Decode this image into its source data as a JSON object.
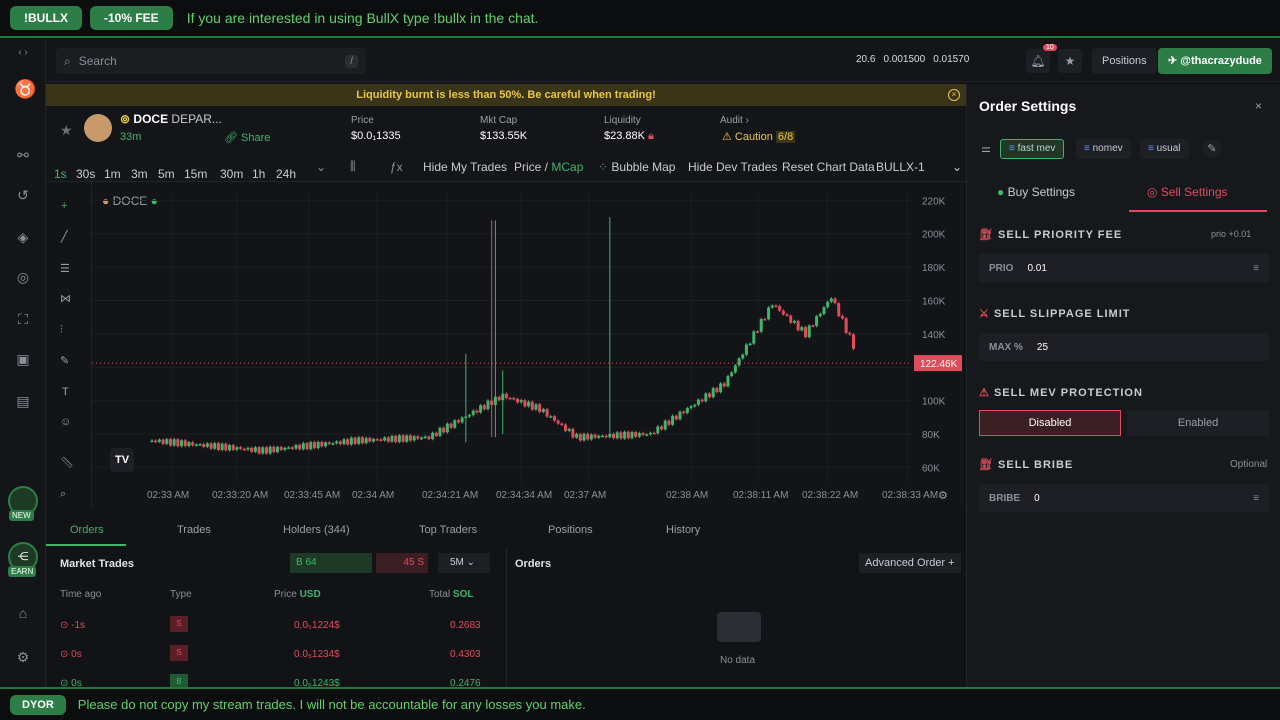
{
  "top_banner": {
    "pill1": "!BULLX",
    "pill2": "-10% FEE",
    "text": "If you are interested in using BullX type !bullx in the chat."
  },
  "bottom_banner": {
    "pill": "DYOR",
    "text": "Please do not copy my stream trades. I will not be accountable for any losses you make."
  },
  "header": {
    "search_placeholder": "Search",
    "search_shortcut": "/",
    "stat1": "20.6",
    "stat2": "0.001500",
    "stat3": "0.01570",
    "notif_count": "10",
    "positions": "Positions",
    "telegram": "@thacrazydude"
  },
  "sidebar_badges": {
    "new": "NEW",
    "earn": "EARN"
  },
  "warning": "Liquidity burnt is less than 50%. Be careful when trading!",
  "token": {
    "name": "DOCE",
    "full": "DEPAR...",
    "age": "33m",
    "share": "Share",
    "price_label": "Price",
    "price": "$0.0₁1335",
    "mcap_label": "Mkt Cap",
    "mcap": "$133.55K",
    "liq_label": "Liquidity",
    "liq": "$23.88K",
    "audit_label": "Audit",
    "audit": "Caution",
    "audit_score": "6/8"
  },
  "timeframes": [
    "1s",
    "30s",
    "1m",
    "3m",
    "5m",
    "15m",
    "30m",
    "1h",
    "24h"
  ],
  "chart_toolbar": {
    "hide_my_trades": "Hide My Trades",
    "price": "Price",
    "mcap": "MCap",
    "bubble": "Bubble Map",
    "hide_dev": "Hide Dev Trades",
    "reset": "Reset Chart Data",
    "layout": "BULLX-1"
  },
  "chart_data": {
    "type": "candlestick",
    "symbol": "DOCE",
    "current_price_label": "122.46K",
    "y_ticks": [
      "220K",
      "200K",
      "180K",
      "160K",
      "140K",
      "120K",
      "100K",
      "80K",
      "60K"
    ],
    "x_ticks": [
      "02:33 AM",
      "02:33:20 AM",
      "02:33:45 AM",
      "02:34 AM",
      "02:34:21 AM",
      "02:34:34 AM",
      "02:37 AM",
      "02:38 AM",
      "02:38:11 AM",
      "02:38:22 AM",
      "02:38:33 AM"
    ],
    "ylim": [
      50000,
      225000
    ],
    "grid": true
  },
  "bottom_tabs": [
    "Orders",
    "Trades",
    "Holders (344)",
    "Top Traders",
    "Positions",
    "History"
  ],
  "market_trades": {
    "title": "Market Trades",
    "buy_count": "B 64",
    "sell_count": "45 S",
    "interval": "5M",
    "col_time": "Time ago",
    "col_type": "Type",
    "col_price": "Price",
    "col_price_unit": "USD",
    "col_total": "Total",
    "col_total_unit": "SOL",
    "rows": [
      {
        "time": "-1s",
        "type": "S",
        "price": "0.0₅1224$",
        "total": "0.2683"
      },
      {
        "time": "0s",
        "type": "S",
        "price": "0.0₅1234$",
        "total": "0.4303"
      },
      {
        "time": "0s",
        "type": "B",
        "price": "0.0₅1243$",
        "total": "0.2476"
      }
    ]
  },
  "orders_panel": {
    "title": "Orders",
    "advanced": "Advanced Order",
    "empty": "No data"
  },
  "order_settings": {
    "title": "Order Settings",
    "presets": [
      "fast mev",
      "nomev",
      "usual"
    ],
    "buy_tab": "Buy Settings",
    "sell_tab": "Sell Settings",
    "priority_label": "SELL PRIORITY FEE",
    "priority_hint": "prio +0.01",
    "prio_key": "PRIO",
    "prio_val": "0.01",
    "slippage_label": "SELL SLIPPAGE LIMIT",
    "max_key": "MAX %",
    "max_val": "25",
    "mev_label": "SELL MEV PROTECTION",
    "mev_disabled": "Disabled",
    "mev_enabled": "Enabled",
    "bribe_label": "SELL BRIBE",
    "bribe_hint": "Optional",
    "bribe_key": "BRIBE",
    "bribe_val": "0"
  }
}
